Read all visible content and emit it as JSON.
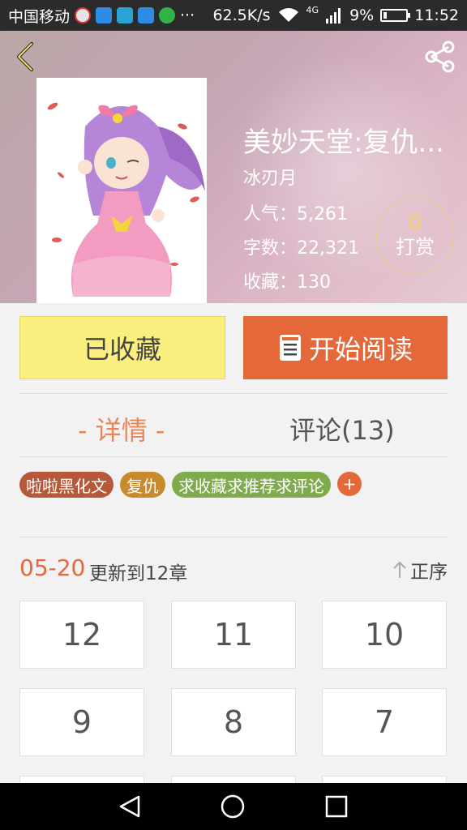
{
  "status_bar": {
    "carrier": "中国移动",
    "dots": "···",
    "network_speed": "62.5K/s",
    "network_type": "4G",
    "battery": "9%",
    "time": "11:52",
    "icons": [
      "weibo-icon",
      "wifi-app-icon",
      "message-icon",
      "wifi-app-icon",
      "wechat-icon",
      "wifi-icon",
      "signal-icon",
      "battery-icon"
    ]
  },
  "book": {
    "title": "美妙天堂:复仇...",
    "author": "冰刃月",
    "popularity": "人气：5,261",
    "word_count": "字数：22,321",
    "favorites": "收藏：130",
    "reward_count": "0",
    "reward_label": "打赏"
  },
  "actions": {
    "favorited_label": "已收藏",
    "read_label": "开始阅读"
  },
  "tabs": {
    "detail": "- 详情 -",
    "comments": "评论(13)"
  },
  "tags": [
    "啦啦黑化文",
    "复仇",
    "求收藏求推荐求评论"
  ],
  "tag_add": "+",
  "update": {
    "date": "05-20",
    "text": "更新到12章",
    "sort_label": "正序"
  },
  "chapters": [
    "12",
    "11",
    "10",
    "9",
    "8",
    "7"
  ],
  "colors": {
    "accent_orange": "#e4683a",
    "favorite_yellow": "#fbf07f",
    "reward_gold": "#f5cf6a"
  }
}
